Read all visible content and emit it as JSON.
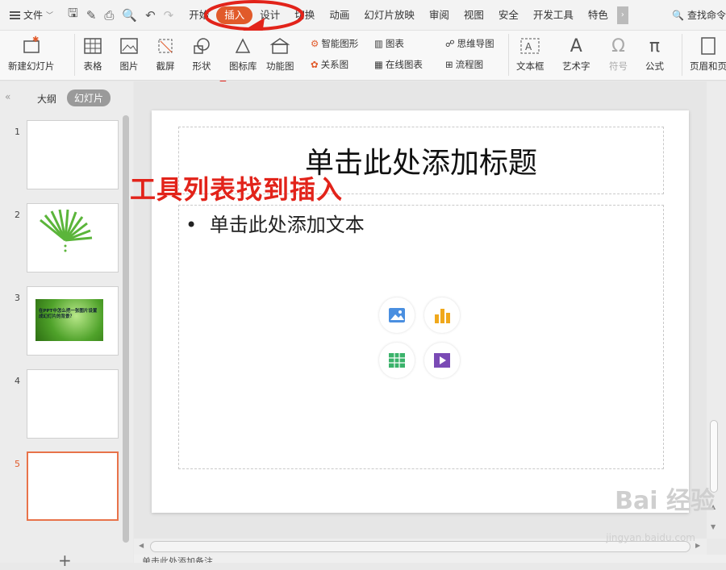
{
  "menubar": {
    "file_label": "文件",
    "tabs": [
      "开始",
      "插入",
      "设计",
      "切换",
      "动画",
      "幻灯片放映",
      "审阅",
      "视图",
      "安全",
      "开发工具",
      "特色"
    ],
    "active_tab": "插入",
    "search_label": "查找命令"
  },
  "toolbar": {
    "new_slide": "新建幻灯片",
    "table": "表格",
    "picture": "图片",
    "screenshot": "截屏",
    "shape": "形状",
    "icon_lib": "图标库",
    "func_chart": "功能图",
    "smart_shape": "智能图形",
    "chart": "图表",
    "relation": "关系图",
    "online_chart": "在线图表",
    "mindmap": "思维导图",
    "flowchart": "流程图",
    "textbox": "文本框",
    "wordart": "艺术字",
    "symbol": "符号",
    "formula": "公式",
    "header_footer": "页眉和页"
  },
  "left_panel": {
    "tab_outline": "大纲",
    "tab_slides": "幻灯片",
    "slide_numbers": [
      "1",
      "2",
      "3",
      "4",
      "5"
    ],
    "slide3_text": "在PPT中怎么把一张图片设置成幻灯片的背景？"
  },
  "slide": {
    "title_placeholder": "单击此处添加标题",
    "body_placeholder": "单击此处添加文本",
    "bullet": "•"
  },
  "annotation": {
    "text": "工具列表找到插入",
    "color": "#e2231a"
  },
  "footer": {
    "notes_placeholder": "单击此处添加备注"
  },
  "watermark": {
    "brand": "Bai 经验",
    "url": "jingyan.baidu.com"
  },
  "colors": {
    "accent": "#e15a2a",
    "selected_border": "#e8734a"
  }
}
